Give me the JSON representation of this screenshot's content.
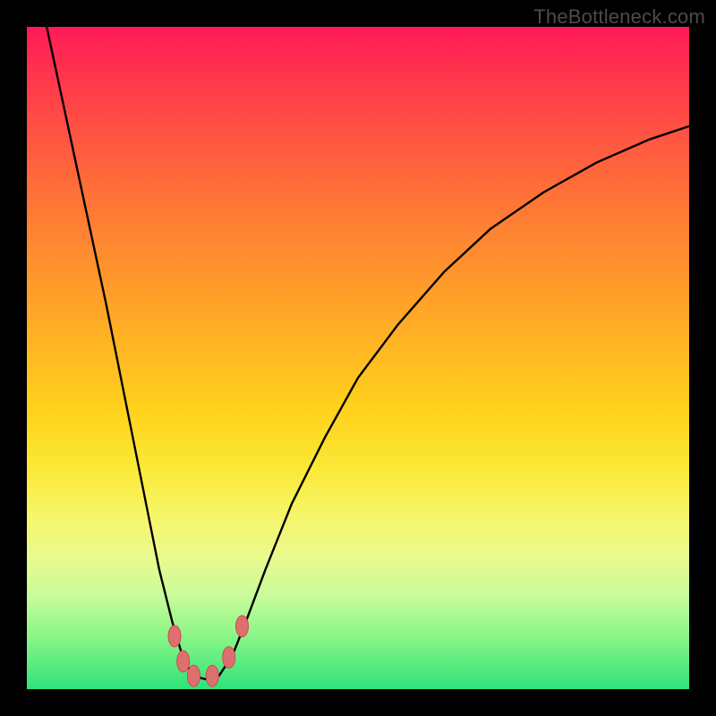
{
  "watermark": "TheBottleneck.com",
  "chart_data": {
    "type": "line",
    "title": "",
    "xlabel": "",
    "ylabel": "",
    "xlim": [
      0,
      100
    ],
    "ylim": [
      0,
      100
    ],
    "series": [
      {
        "name": "bottleneck-curve",
        "x": [
          3,
          6,
          9,
          12,
          14,
          16,
          18,
          20,
          22,
          23.5,
          25,
          27,
          29,
          31,
          33,
          36,
          40,
          45,
          50,
          56,
          63,
          70,
          78,
          86,
          94,
          100
        ],
        "values": [
          100,
          86,
          72,
          58,
          48,
          38,
          28,
          18,
          10,
          5,
          2,
          1.5,
          2,
          5,
          10,
          18,
          28,
          38,
          47,
          55,
          63,
          69.5,
          75,
          79.5,
          83,
          85
        ]
      }
    ],
    "markers": [
      {
        "name": "left-marker-1",
        "x": 22.3,
        "y": 8.0
      },
      {
        "name": "left-marker-2",
        "x": 23.6,
        "y": 4.2
      },
      {
        "name": "trough-marker-1",
        "x": 25.2,
        "y": 2.0
      },
      {
        "name": "trough-marker-2",
        "x": 28.0,
        "y": 2.0
      },
      {
        "name": "right-marker-1",
        "x": 30.5,
        "y": 4.8
      },
      {
        "name": "right-marker-2",
        "x": 32.5,
        "y": 9.5
      }
    ],
    "marker_style": {
      "color": "#de6f6f",
      "rx": 7,
      "ry": 12,
      "stroke": "#c94f4f"
    }
  }
}
